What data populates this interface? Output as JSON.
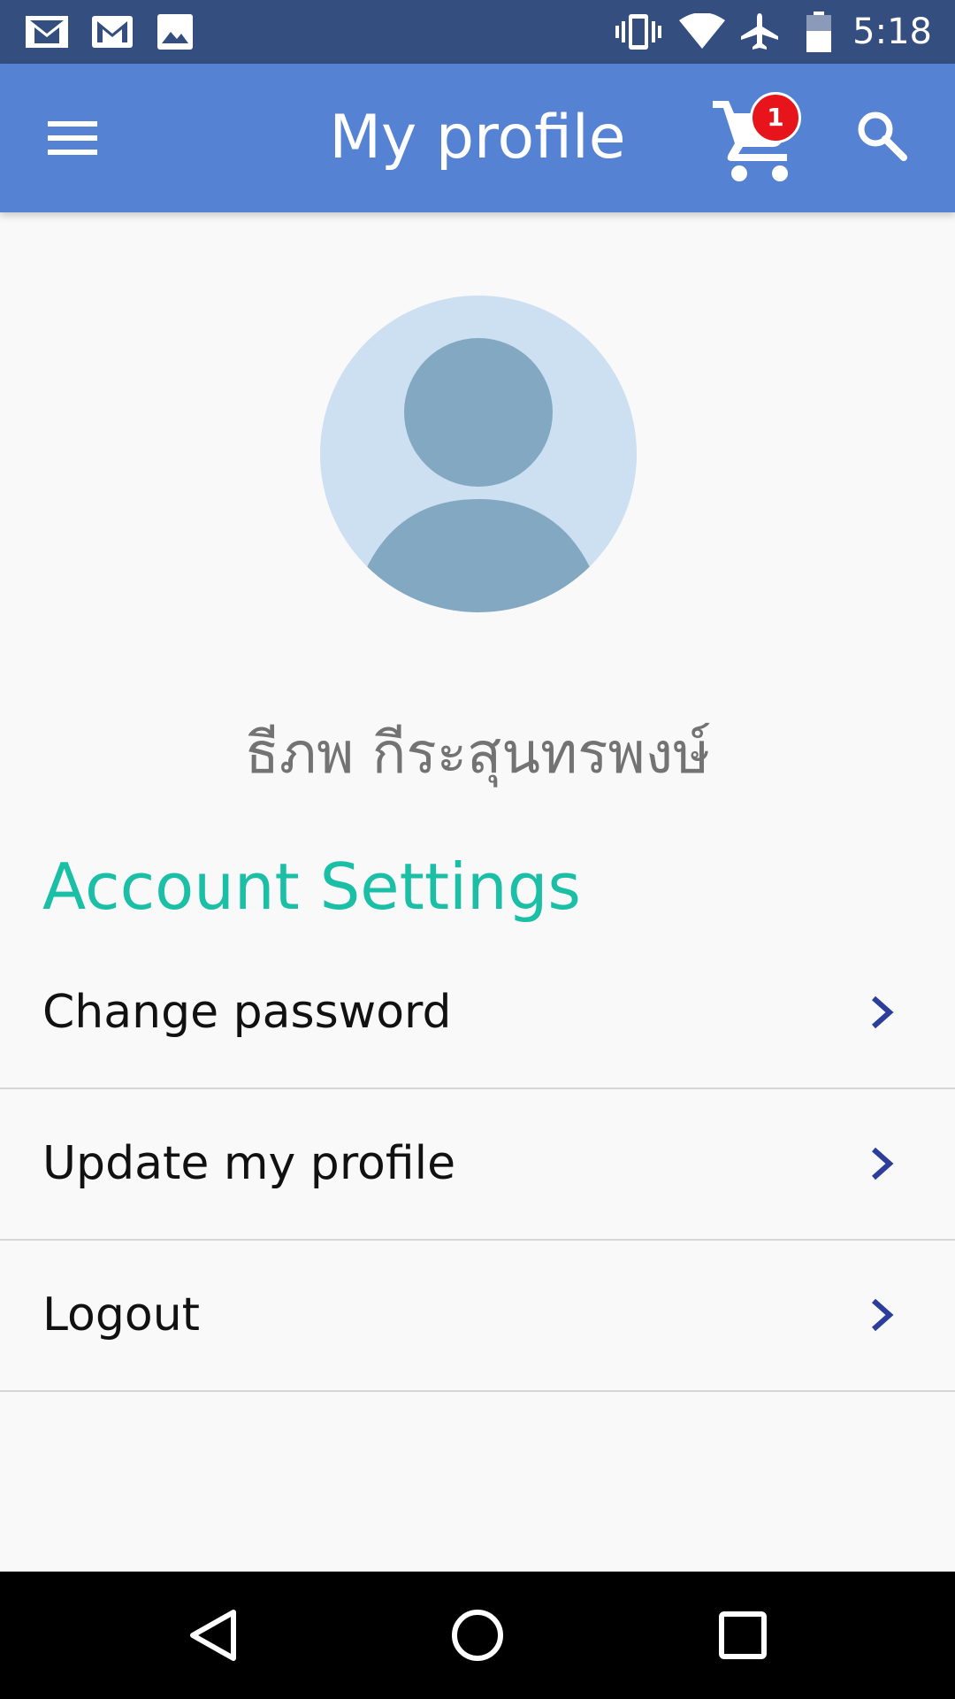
{
  "status_bar": {
    "time": "5:18",
    "left_icons": [
      "gmail-inbox-icon",
      "gmail-icon",
      "image-icon"
    ],
    "right_icons": [
      "vibrate-icon",
      "wifi-icon",
      "airplane-icon",
      "battery-icon"
    ]
  },
  "app_bar": {
    "title": "My profile",
    "cart_count": "1",
    "accent_color": "#5682d3"
  },
  "profile": {
    "name": "ธีภพ กีระสุนทรพงษ์"
  },
  "account_settings": {
    "title": "Account Settings",
    "items": [
      {
        "label": "Change password"
      },
      {
        "label": "Update my profile"
      },
      {
        "label": "Logout"
      }
    ]
  },
  "colors": {
    "status_bar": "#344e7f",
    "section_title": "#1bbfa6",
    "chevron": "#2c3e9a",
    "badge": "#e8141c"
  }
}
